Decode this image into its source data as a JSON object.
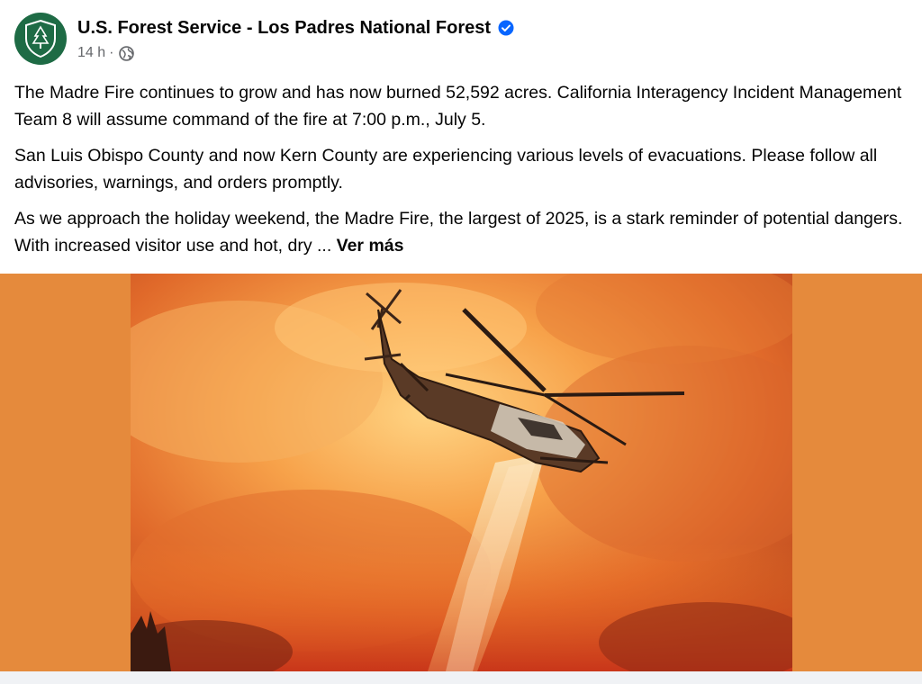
{
  "post": {
    "author": "U.S. Forest Service - Los Padres National Forest",
    "timestamp": "14 h",
    "separator": "·",
    "avatar_icon": "forest-service-shield-icon",
    "verified_icon": "verified-badge-icon",
    "audience_icon": "globe-icon",
    "paragraphs": [
      "The Madre Fire continues to grow and has now burned 52,592 acres. California Interagency Incident Management Team 8 will assume command of the fire at 7:00 p.m., July 5.",
      "San Luis Obispo County and now Kern County are experiencing various levels of evacuations. Please follow all advisories, warnings, and orders promptly."
    ],
    "truncated_paragraph": "As we approach the holiday weekend, the Madre Fire, the largest of 2025, is a stark reminder of potential dangers. With increased visitor use and hot, dry ... ",
    "see_more_label": "Ver más"
  },
  "colors": {
    "brand_green": "#1e6b45",
    "verified_blue": "#0866ff",
    "media_backdrop": "#e58a3c",
    "secondary_text": "#65676b"
  }
}
